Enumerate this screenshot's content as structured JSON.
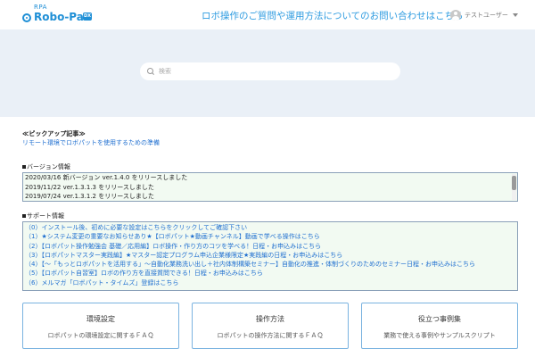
{
  "header": {
    "logo_prefix": "RPA",
    "logo_text": "Robo-Pat",
    "logo_badge": "DX",
    "contact_link": "ロボ操作のご質問や運用方法についてのお問い合わせはこちら",
    "user_name": "テストユーザー"
  },
  "search": {
    "placeholder": "検索"
  },
  "pickup": {
    "title": "≪ピックアップ記事≫",
    "link": "リモート環境でロボパットを使用するための準備"
  },
  "version": {
    "heading": "バージョン情報",
    "rows": [
      "2020/03/16 新バージョン ver.1.4.0 をリリースしました",
      "2019/11/22 ver.1.3.1.3 をリリースしました",
      "2019/07/24 ver.1.3.1.2 をリリースしました"
    ]
  },
  "support": {
    "heading": "サポート情報",
    "rows": [
      "（0）インストール後、初めに必要な設定はこちらをクリックしてご確認下さい",
      "（1）★システム変更の重要なお知らせあり★【ロボパット★動画チャンネル】動画で学べる操作はこちら",
      "（2）【ロボパット操作勉強会 基礎／応用編】ロボ操作・作り方のコツを学べる！日程・お申込みはこちら",
      "（3）【ロボパットマスター実践編】★マスター認定プログラム申込企業様限定★実践編の日程・お申込みはこちら",
      "（4）【～「もっとロボパットを活用する」～自動化業務洗い出し＋社内体制構築セミナー】自動化の推進・体制づくりのためのセミナー日程・お申込みはこちら",
      "（5）【ロボパット自習室】ロボの作り方を直接質問できる！日程・お申込みはこちら",
      "（6）メルマガ「ロボパット・タイムズ」登録はこちら"
    ]
  },
  "cards": [
    {
      "title": "環境設定",
      "desc": "ロボパットの環境設定に関するＦＡＱ"
    },
    {
      "title": "操作方法",
      "desc": "ロボパットの操作方法に関するＦＡＱ"
    },
    {
      "title": "役立つ事例集",
      "desc": "業務で使える事例やサンプルスクリプト"
    }
  ]
}
